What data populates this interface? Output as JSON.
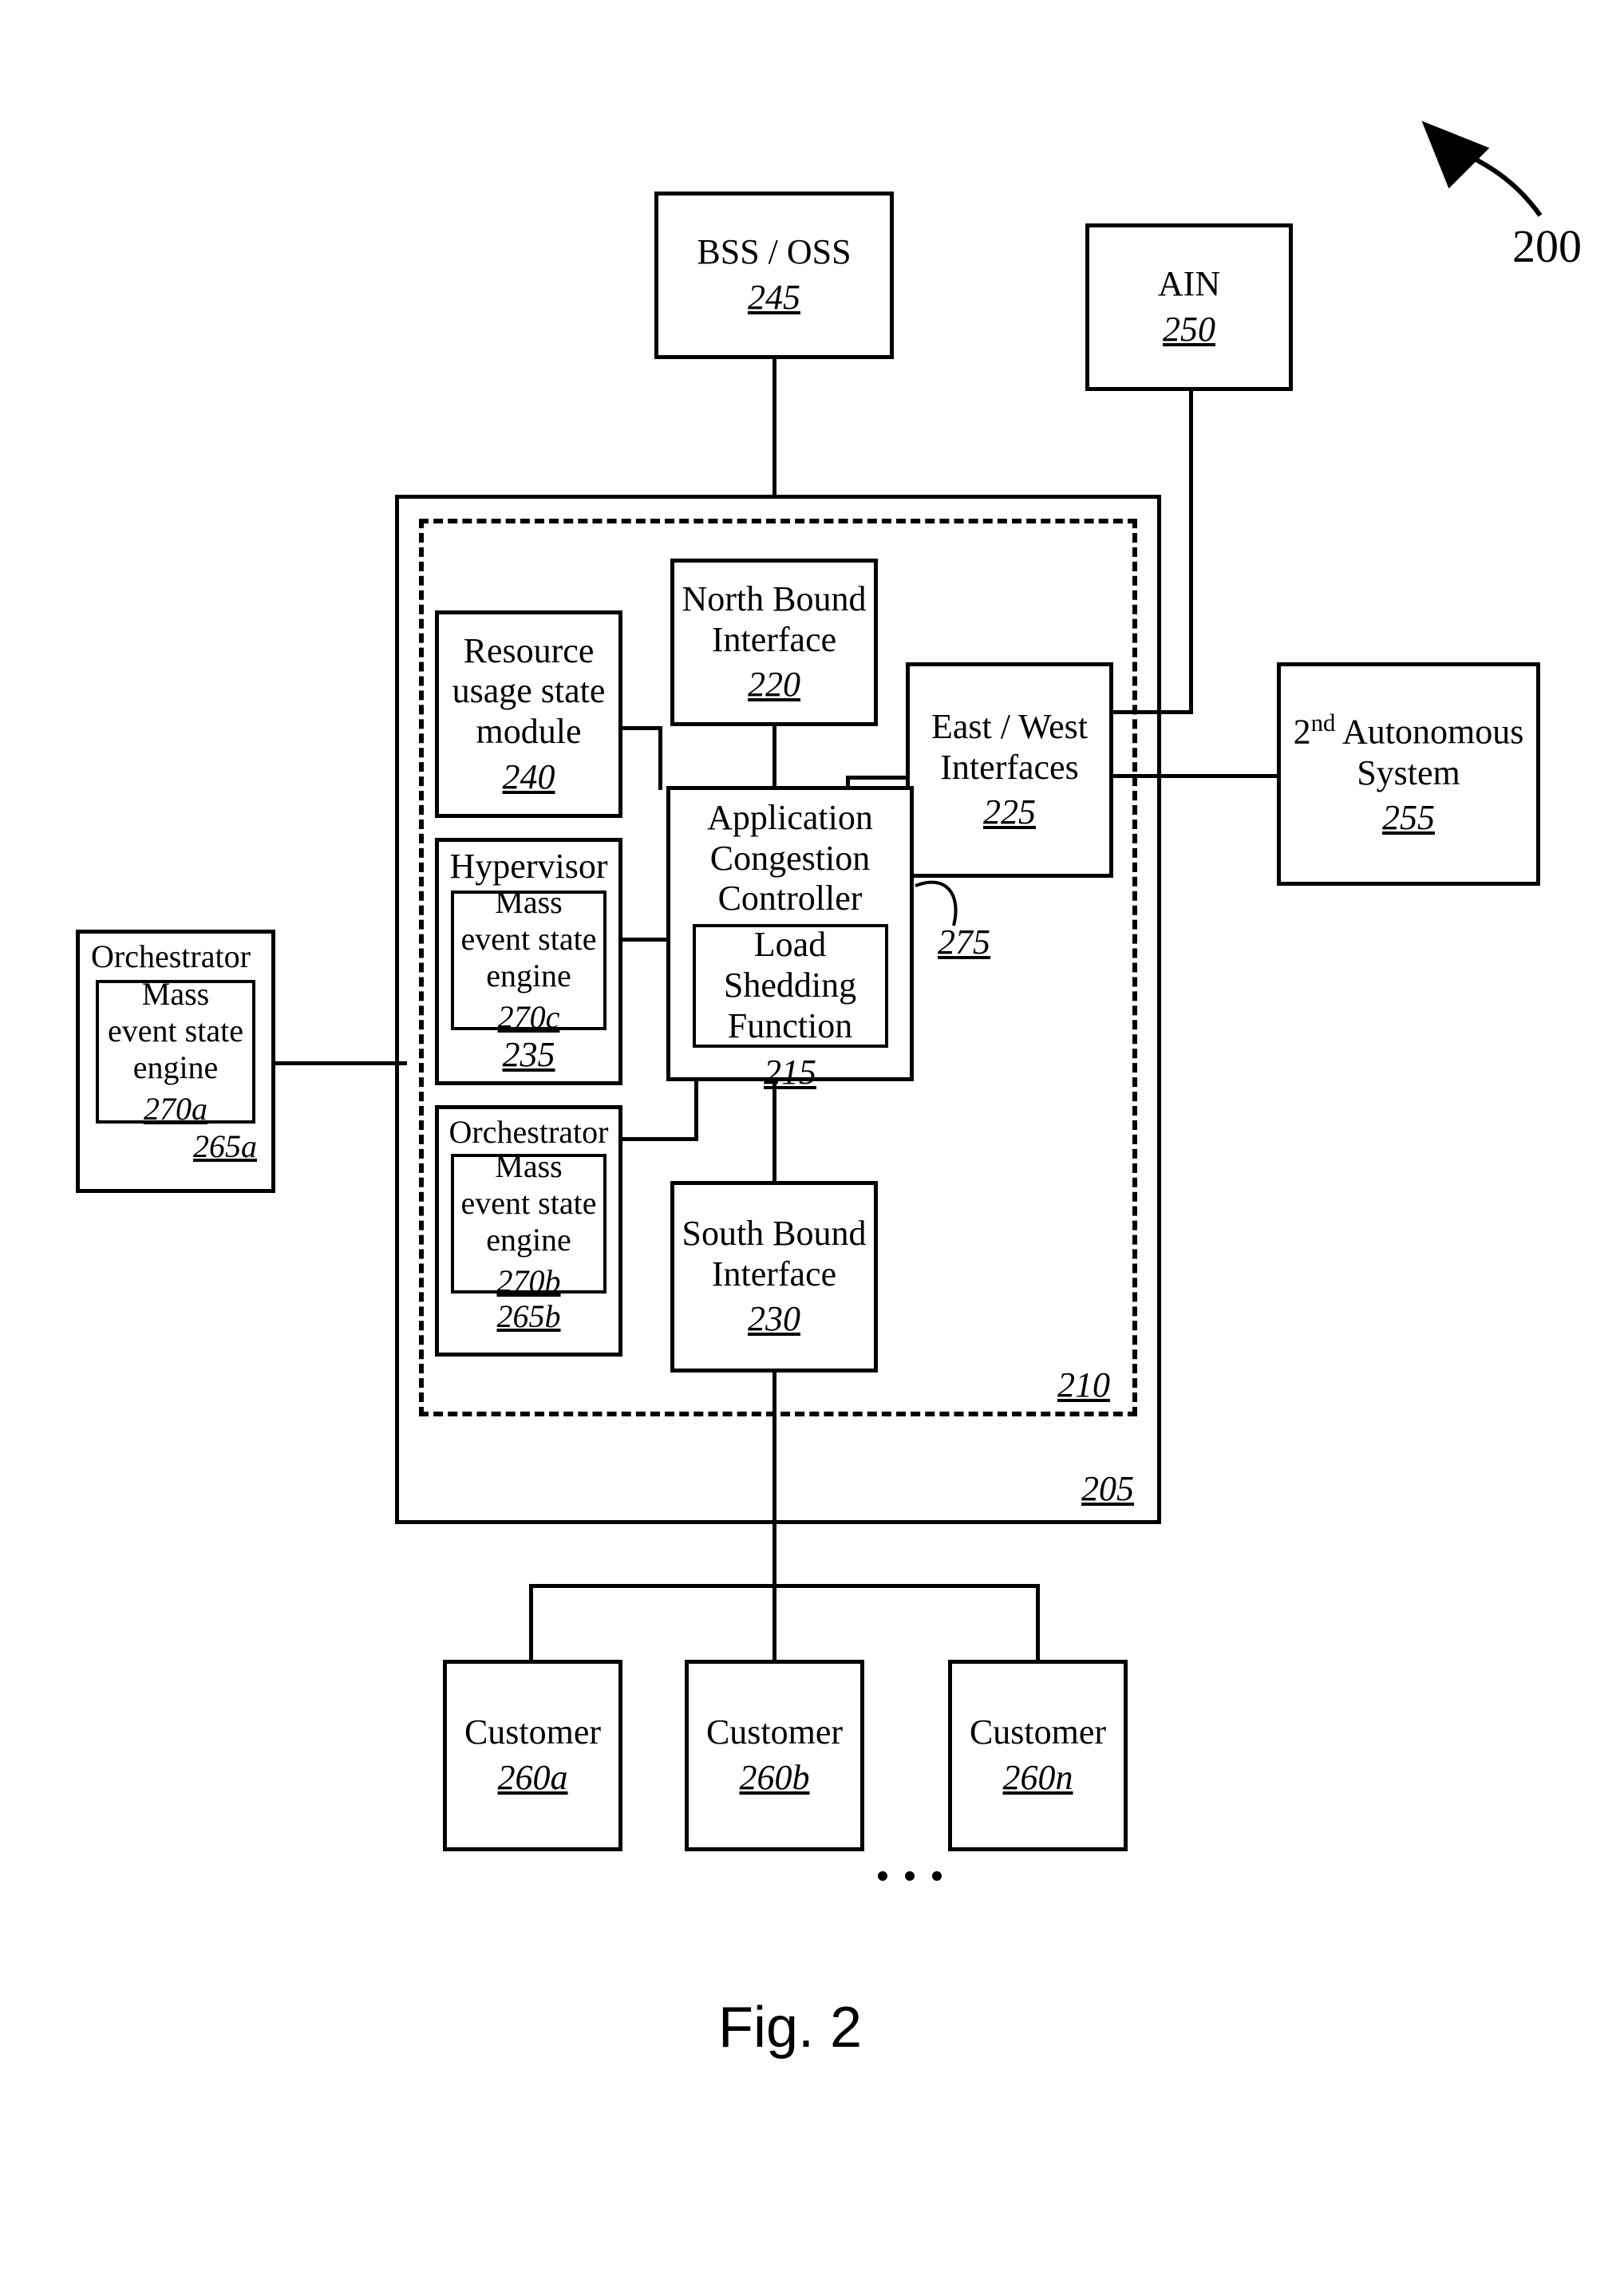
{
  "figure_ref": "200",
  "figure_label": "Fig. 2",
  "blocks": {
    "bss_oss": {
      "label": "BSS / OSS",
      "ref": "245"
    },
    "ain": {
      "label": "AIN",
      "ref": "250"
    },
    "second_as": {
      "label_pre": "2",
      "label_sup": "nd",
      "label_post": " Autonomous System",
      "ref": "255"
    },
    "north": {
      "label": "North Bound Interface",
      "ref": "220"
    },
    "east_west": {
      "label": "East / West Interfaces",
      "ref": "225"
    },
    "south": {
      "label": "South Bound Interface",
      "ref": "230"
    },
    "acc": {
      "label": "Application Congestion Controller",
      "ref": "215"
    },
    "load_shed": {
      "label": "Load Shedding Function",
      "ref": "275"
    },
    "res_usage": {
      "label": "Resource usage state module",
      "ref": "240"
    },
    "hypervisor": {
      "label": "Hypervisor",
      "ref": "235"
    },
    "mese_c": {
      "label": "Mass event state engine",
      "ref": "270c"
    },
    "orch_b": {
      "label": "Orchestrator",
      "ref": "265b"
    },
    "mese_b": {
      "label": "Mass event state engine",
      "ref": "270b"
    },
    "orch_a": {
      "label": "Orchestrator",
      "ref": "265a"
    },
    "mese_a": {
      "label": "Mass event state engine",
      "ref": "270a"
    },
    "cust_a": {
      "label": "Customer",
      "ref": "260a"
    },
    "cust_b": {
      "label": "Customer",
      "ref": "260b"
    },
    "cust_n": {
      "label": "Customer",
      "ref": "260n"
    },
    "dashed": {
      "ref": "210"
    },
    "solid_outer": {
      "ref": "205"
    }
  }
}
